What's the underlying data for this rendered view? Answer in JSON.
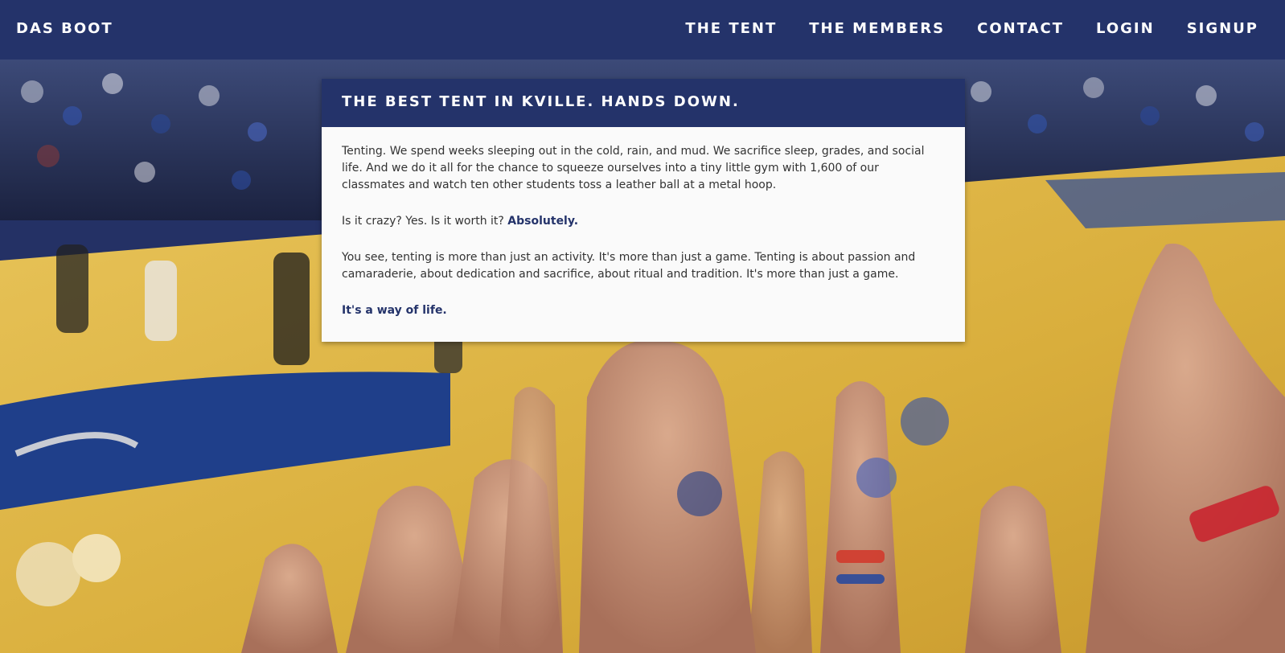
{
  "navbar": {
    "brand": "DAS BOOT",
    "links": [
      "THE TENT",
      "THE MEMBERS",
      "CONTACT",
      "LOGIN",
      "SIGNUP"
    ]
  },
  "card": {
    "title": "THE BEST TENT IN KVILLE. HANDS DOWN.",
    "paragraph1": "Tenting. We spend weeks sleeping out in the cold, rain, and mud. We sacrifice sleep, grades, and social life. And we do it all for the chance to squeeze ourselves into a tiny little gym with 1,600 of our classmates and watch ten other students toss a leather ball at a metal hoop.",
    "paragraph2_lead": "Is it crazy? Yes. Is it worth it? ",
    "paragraph2_emphasis": "Absolutely.",
    "paragraph3": "You see, tenting is more than just an activity. It's more than just a game. Tenting is about passion and camaraderie, about dedication and sacrifice, about ritual and tradition. It's more than just a game.",
    "closing": "It's a way of life."
  },
  "colors": {
    "primary": "#24336a",
    "card_background": "#fafafa",
    "body_text": "#333333"
  }
}
